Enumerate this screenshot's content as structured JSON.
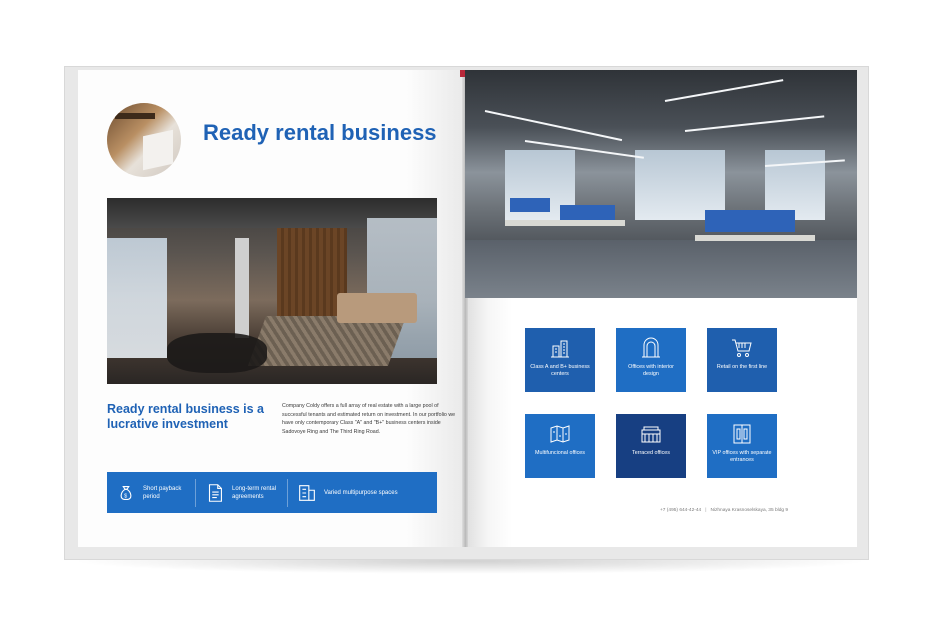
{
  "left_page": {
    "title": "Ready rental business",
    "subheading": "Ready rental  business is a lucrative investment",
    "paragraph": "Company Coldy offers a full array of real estate with a large pool of successful tenants and estimated return on investment. In our portfolio we have only contemporary Class \"A\" and \"B+\" business centers inside Sadovoye Ring and The Third Ring Road.",
    "features": [
      {
        "icon": "money-bag-icon",
        "label": "Short payback period"
      },
      {
        "icon": "document-icon",
        "label": "Long-term rental agreements"
      },
      {
        "icon": "building-layout-icon",
        "label": "Varied multipurpose spaces"
      }
    ]
  },
  "right_page": {
    "tiles": [
      {
        "icon": "business-center-icon",
        "label": "Class A and B+ business centers",
        "color": "#1f5fae"
      },
      {
        "icon": "interior-arch-icon",
        "label": "Offices with interior design",
        "color": "#1f6ec4"
      },
      {
        "icon": "shopping-cart-icon",
        "label": "Retail on the first line",
        "color": "#1f5fae"
      },
      {
        "icon": "floor-plan-icon",
        "label": "Multifuncional offices",
        "color": "#1f6ec4"
      },
      {
        "icon": "terrace-icon",
        "label": "Terraced offices",
        "color": "#173f82"
      },
      {
        "icon": "doors-icon",
        "label": "VIP offices with separate entrances",
        "color": "#1f6ec4"
      }
    ],
    "footer": {
      "phone": "+7 (495) 644-42-44",
      "separator": "|",
      "address": "Nizhnaya Krasnoselskaya, 35 bldg 9"
    }
  },
  "colors": {
    "accent": "#1f62b5",
    "bar": "#1f6ec4",
    "ribbon": "#b8283a"
  }
}
